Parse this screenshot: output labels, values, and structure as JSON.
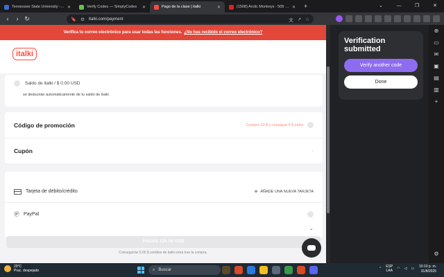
{
  "browser": {
    "tabs": [
      {
        "title": "Tennessee State University - Official",
        "color": "#3a6fd0"
      },
      {
        "title": "Verify Codes — SimplyCodes",
        "color": "#6cc04a"
      },
      {
        "title": "Pago de la clase | italki",
        "color": "#ff4b3e"
      },
      {
        "title": "(1508) Arctic Monkeys - 505 // S",
        "color": "#e02020"
      }
    ],
    "url": "italki.com/payment"
  },
  "page": {
    "banner_text": "Verifica tu correo electrónico para usar todas las funciones.",
    "banner_link": "¿No has recibido el correo electrónico?",
    "logo": "italki",
    "balance_label": "Saldo de italki / $ 0.00 USD",
    "balance_sub": "se deducirán automáticamente de tu saldo de italki",
    "promo_title": "Código de promoción",
    "promo_offer": "Compra 10 $ y consigue 5 $ extra",
    "coupon_title": "Cupón",
    "card_label": "Tarjeta de débito/crédito",
    "add_card": "AÑADE UNA NUEVA TARJETA",
    "paypal_label": "PayPal",
    "pay_button": "PAGAS 120.00 USD",
    "credit_note": "Conseguirás 5.00 $ créditos de italki extra tras la compra."
  },
  "popup": {
    "title": "Verification submitted",
    "verify_button": "Verify another code",
    "done_button": "Done"
  },
  "taskbar": {
    "temp": "20°C",
    "weather": "Prac. despejado",
    "search": "Buscar",
    "lang1": "ESP",
    "lang2": "LAA",
    "time": "10:10 p. m.",
    "date": "31/8/2025"
  }
}
